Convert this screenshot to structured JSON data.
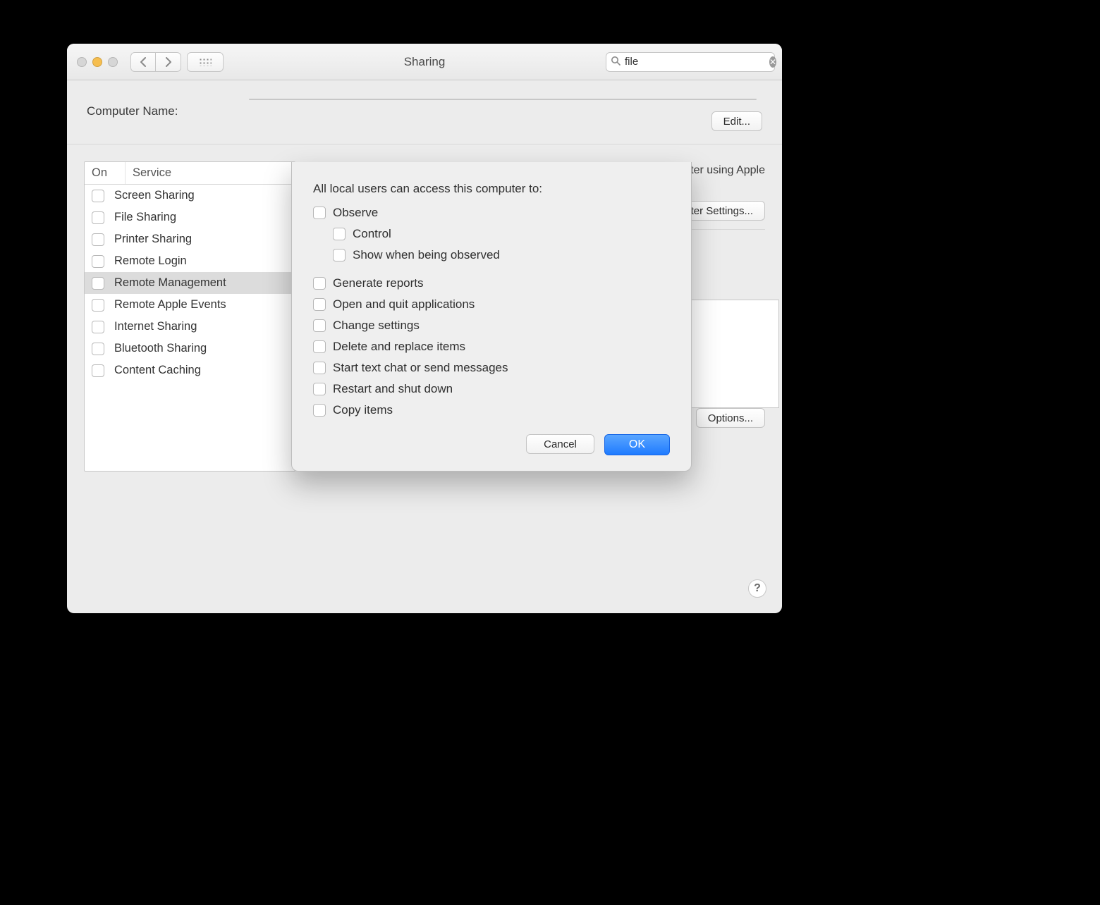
{
  "toolbar": {
    "title": "Sharing",
    "search_value": "file"
  },
  "computer_name": {
    "label": "Computer Name:",
    "value": "",
    "edit_label": "Edit..."
  },
  "services": {
    "col_on": "On",
    "col_service": "Service",
    "rows": [
      {
        "label": "Screen Sharing",
        "on": false,
        "selected": false
      },
      {
        "label": "File Sharing",
        "on": false,
        "selected": false
      },
      {
        "label": "Printer Sharing",
        "on": false,
        "selected": false
      },
      {
        "label": "Remote Login",
        "on": false,
        "selected": false
      },
      {
        "label": "Remote Management",
        "on": false,
        "selected": true
      },
      {
        "label": "Remote Apple Events",
        "on": false,
        "selected": false
      },
      {
        "label": "Internet Sharing",
        "on": false,
        "selected": false
      },
      {
        "label": "Bluetooth Sharing",
        "on": false,
        "selected": false
      },
      {
        "label": "Content Caching",
        "on": false,
        "selected": false
      }
    ]
  },
  "detail": {
    "description_fragment": "s computer using Apple",
    "computer_settings_fragment": "omputer Settings...",
    "options_label": "Options..."
  },
  "sheet": {
    "title": "All local users can access this computer to:",
    "options": [
      {
        "label": "Observe",
        "indent": 0
      },
      {
        "label": "Control",
        "indent": 1
      },
      {
        "label": "Show when being observed",
        "indent": 1
      },
      {
        "label": "Generate reports",
        "indent": 0,
        "gap_before": true
      },
      {
        "label": "Open and quit applications",
        "indent": 0
      },
      {
        "label": "Change settings",
        "indent": 0
      },
      {
        "label": "Delete and replace items",
        "indent": 0
      },
      {
        "label": "Start text chat or send messages",
        "indent": 0
      },
      {
        "label": "Restart and shut down",
        "indent": 0
      },
      {
        "label": "Copy items",
        "indent": 0
      }
    ],
    "cancel_label": "Cancel",
    "ok_label": "OK"
  }
}
